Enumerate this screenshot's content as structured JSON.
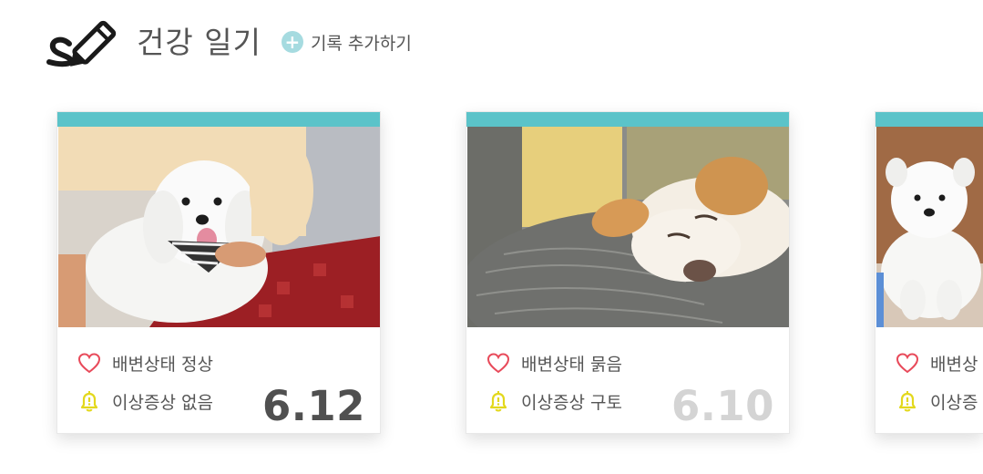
{
  "header": {
    "title": "건강 일기",
    "add_label": "기록 추가하기"
  },
  "cards": [
    {
      "stool_status": "배변상태 정상",
      "symptom_status": "이상증상 없음",
      "date": "6.12"
    },
    {
      "stool_status": "배변상태 묽음",
      "symptom_status": "이상증상 구토",
      "date": "6.10"
    },
    {
      "stool_status": "배변상",
      "symptom_status": "이상증"
    }
  ],
  "colors": {
    "accent": "#5bc3c9",
    "heart": "#e84a5a",
    "bell": "#e3d81c",
    "add_button": "#a6dbe0"
  }
}
